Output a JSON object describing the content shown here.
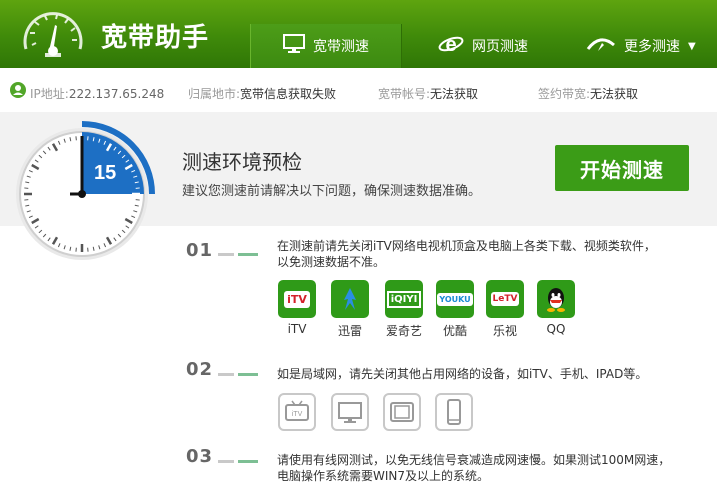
{
  "app": {
    "title": "宽带助手"
  },
  "tabs": [
    {
      "label": "宽带测速",
      "icon": "monitor-icon",
      "active": true
    },
    {
      "label": "网页测速",
      "icon": "ie-browser-icon",
      "active": false
    },
    {
      "label": "更多测速",
      "icon": "speedometer-icon",
      "active": false,
      "dropdown": "▼"
    }
  ],
  "info": {
    "ip_label": "IP地址:",
    "ip_value": "222.137.65.248",
    "region_label": "归属地市:",
    "region_value": "宽带信息获取失败",
    "account_label": "宽带帐号:",
    "account_value": "无法获取",
    "bandwidth_label": "签约带宽:",
    "bandwidth_value": "无法获取"
  },
  "precheck": {
    "timer_value": "15",
    "title": "测速环境预检",
    "subtitle": "建议您测速前请解决以下问题，确保测速数据准确。",
    "start_button": "开始测速"
  },
  "steps": [
    {
      "number": "01",
      "text_line1": "在测速前请先关闭iTV网络电视机顶盒及电脑上各类下载、视频类软件，",
      "text_line2": "以免测速数据不准。"
    },
    {
      "number": "02",
      "text_line1": "如是局域网，请先关闭其他占用网络的设备，如iTV、手机、IPAD等。",
      "text_line2": ""
    },
    {
      "number": "03",
      "text_line1": "请使用有线网测试，以免无线信号衰减造成网速慢。如果测试100M网速，",
      "text_line2": "电脑操作系统需要WIN7及以上的系统。"
    }
  ],
  "apps": [
    {
      "label": "iTV",
      "icon": "itv-app-icon",
      "logo_text": "iTV"
    },
    {
      "label": "迅雷",
      "icon": "xunlei-app-icon",
      "logo_text": ""
    },
    {
      "label": "爱奇艺",
      "icon": "iqiyi-app-icon",
      "logo_text": "iQIYI"
    },
    {
      "label": "优酷",
      "icon": "youku-app-icon",
      "logo_text": "YOUKU"
    },
    {
      "label": "乐视",
      "icon": "letv-app-icon",
      "logo_text": "LeTV"
    },
    {
      "label": "QQ",
      "icon": "qq-app-icon",
      "logo_text": ""
    }
  ],
  "devices": [
    {
      "icon": "tv-box-icon",
      "logo_text": "iTV"
    },
    {
      "icon": "monitor-device-icon"
    },
    {
      "icon": "tablet-icon"
    },
    {
      "icon": "phone-icon"
    }
  ],
  "colors": {
    "header_green": "#3f8a0a",
    "button_green": "#3b9c17",
    "timer_blue": "#1d6fc4"
  }
}
